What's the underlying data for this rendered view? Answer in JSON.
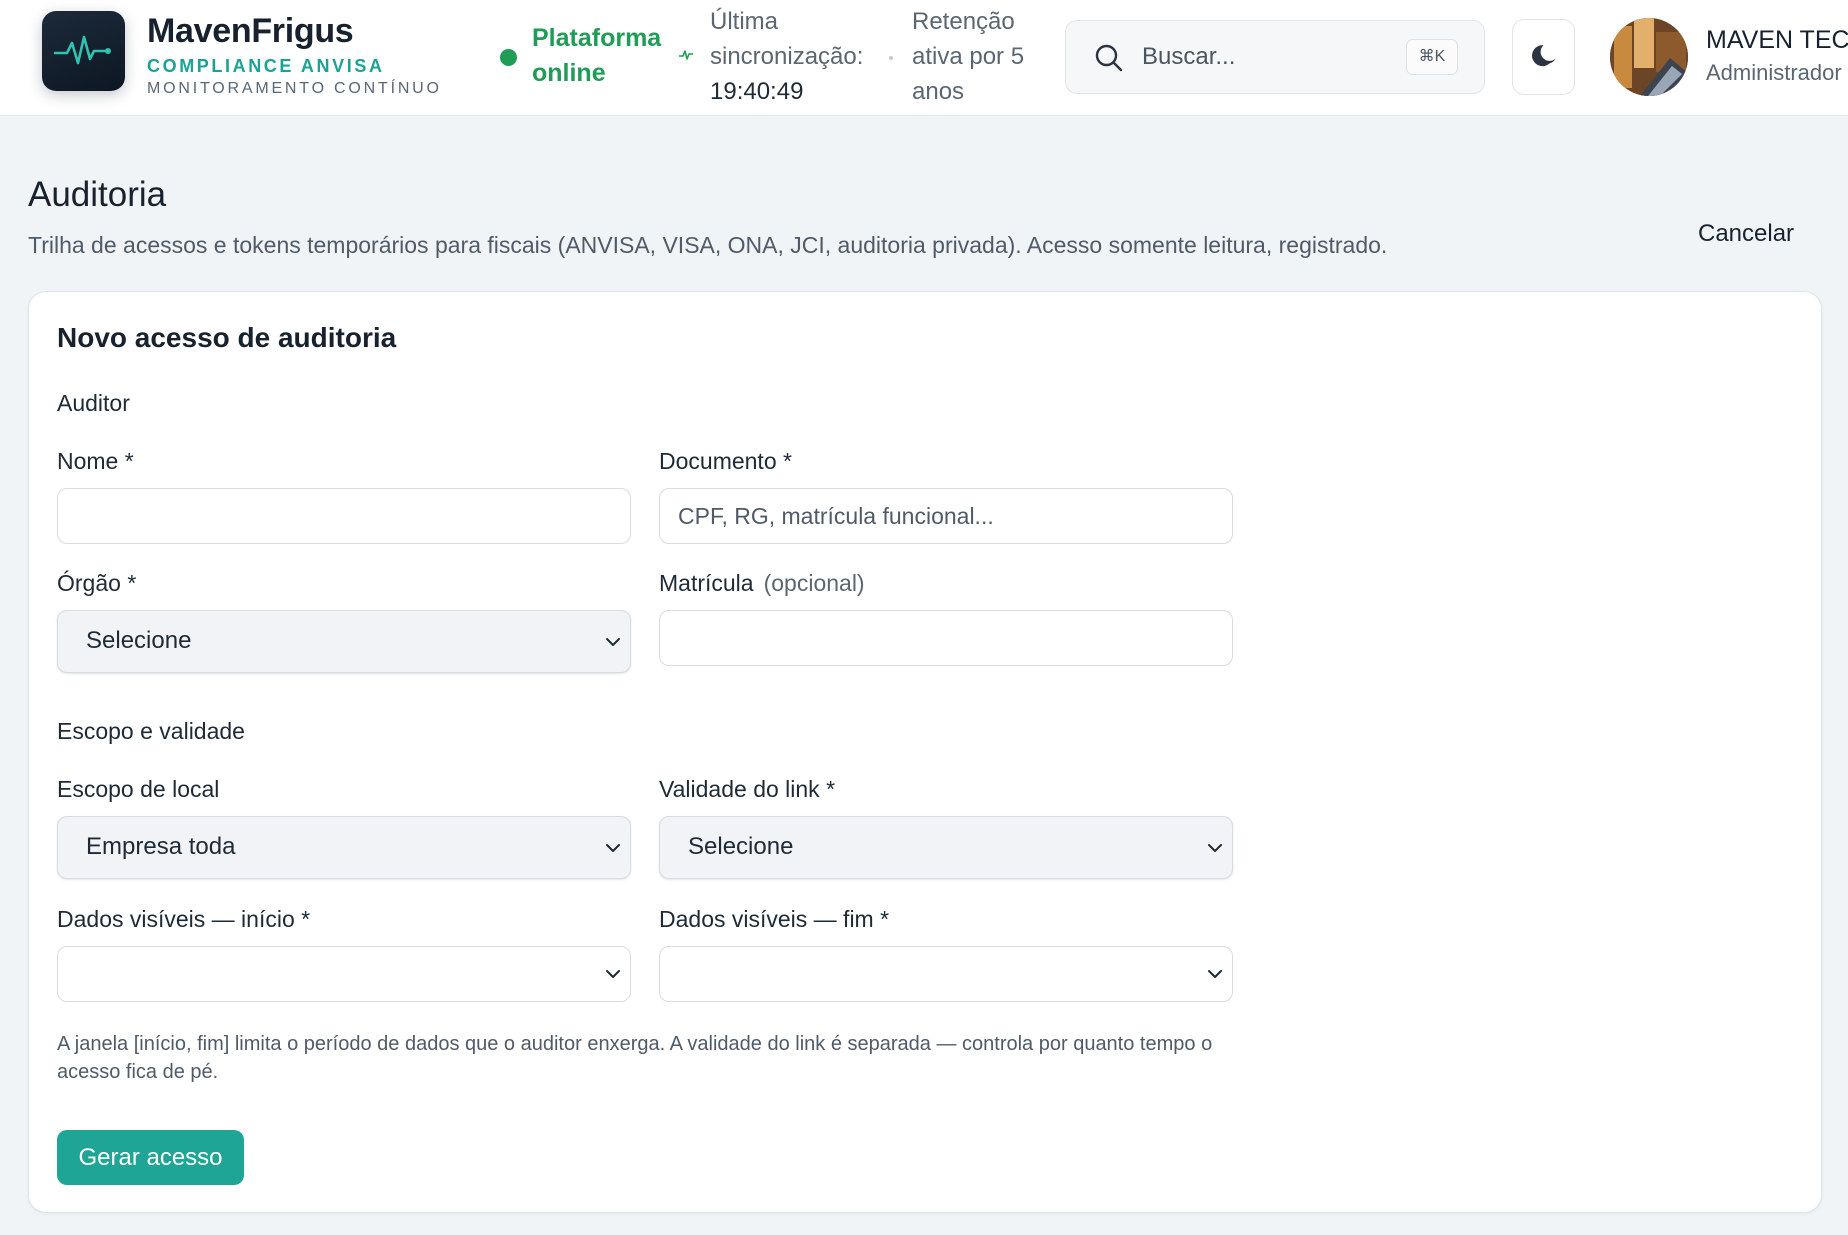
{
  "header": {
    "brand_name": "MavenFrigus",
    "brand_subtitle": "COMPLIANCE ANVISA",
    "brand_tagline": "MONITORAMENTO CONTÍNUO",
    "status": "Plataforma online",
    "sync_label": "Última sincronização:",
    "sync_time": "19:40:49",
    "retention": "Retenção ativa por 5 anos",
    "search_placeholder": "Buscar...",
    "search_shortcut": "⌘K",
    "user_name": "MAVEN TECH",
    "user_role": "Administrador",
    "accent_color": "#1aa394",
    "status_color": "#1f9c55"
  },
  "page": {
    "title": "Auditoria",
    "description": "Trilha de acessos e tokens temporários para fiscais (ANVISA, VISA, ONA, JCI, auditoria privada). Acesso somente leitura, registrado.",
    "cancel_label": "Cancelar"
  },
  "form": {
    "card_title": "Novo acesso de auditoria",
    "section_auditor": "Auditor",
    "nome_label": "Nome *",
    "nome_value": "",
    "documento_label": "Documento *",
    "documento_placeholder": "CPF, RG, matrícula funcional...",
    "orgao_label": "Órgão *",
    "orgao_value": "Selecione",
    "matricula_label": "Matrícula",
    "matricula_optional": "(opcional)",
    "matricula_value": "",
    "section_scope": "Escopo e validade",
    "escopo_label": "Escopo de local",
    "escopo_value": "Empresa toda",
    "validade_label": "Validade do link *",
    "validade_value": "Selecione",
    "inicio_label": "Dados visíveis — início *",
    "inicio_value": "",
    "fim_label": "Dados visíveis — fim *",
    "fim_value": "",
    "hint": "A janela [início, fim] limita o período de dados que o auditor enxerga. A validade do link é separada — controla por quanto tempo o acesso fica de pé.",
    "submit_label": "Gerar acesso",
    "button_color": "#1fa595"
  }
}
